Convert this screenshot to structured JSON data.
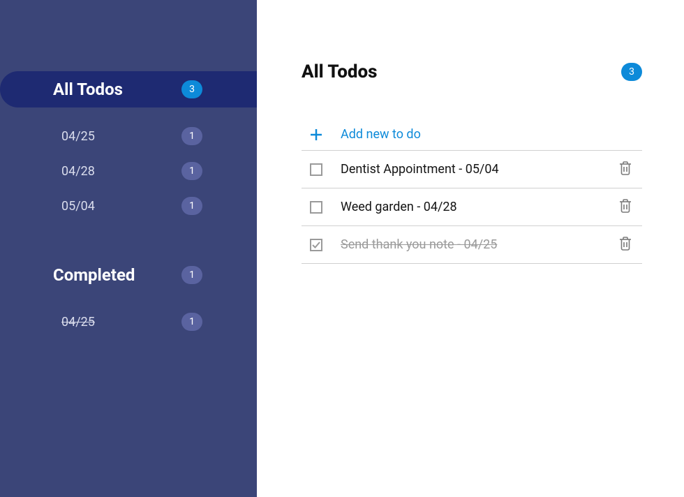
{
  "sidebar": {
    "all": {
      "label": "All Todos",
      "count": "3",
      "items": [
        {
          "label": "04/25",
          "count": "1"
        },
        {
          "label": "04/28",
          "count": "1"
        },
        {
          "label": "05/04",
          "count": "1"
        }
      ]
    },
    "completed": {
      "label": "Completed",
      "count": "1",
      "items": [
        {
          "label": "04/25",
          "count": "1"
        }
      ]
    }
  },
  "main": {
    "title": "All Todos",
    "count": "3",
    "add_label": "Add new to do",
    "todos": [
      {
        "text": "Dentist Appointment - 05/04",
        "completed": false
      },
      {
        "text": "Weed garden - 04/28",
        "completed": false
      },
      {
        "text": "Send thank you note - 04/25",
        "completed": true
      }
    ]
  }
}
